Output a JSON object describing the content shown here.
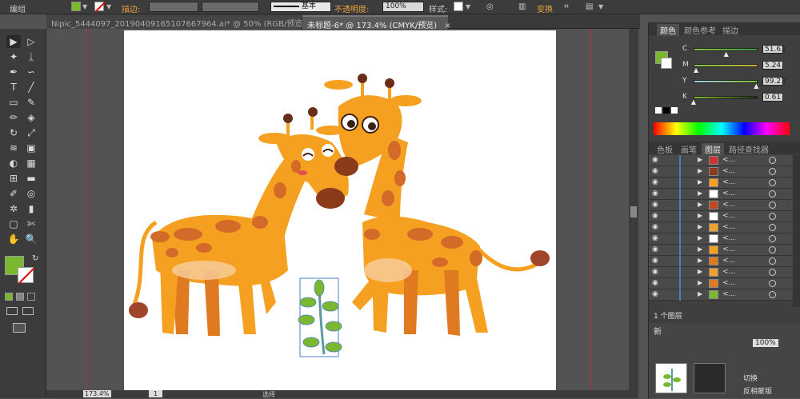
{
  "control_bar": {
    "group_label": "编组",
    "stroke_label": "描边:",
    "stroke_profile": "基本",
    "opacity_label": "不透明度:",
    "opacity_value": "100%",
    "style_label": "样式:",
    "transform_label": "变换",
    "fill_color": "#7ab830"
  },
  "doc_tabs": [
    {
      "title": "Nipic_5444097_20190409165107667964.ai* @ 50% (RGB/预览)",
      "close": "×"
    },
    {
      "title": "未标题-6* @ 173.4% (CMYK/预览)",
      "close": "×"
    }
  ],
  "tools": [
    "selection",
    "direct-selection",
    "magic-wand",
    "lasso",
    "pen",
    "curvature",
    "type",
    "line",
    "rectangle",
    "paintbrush",
    "pencil",
    "eraser",
    "rotate",
    "scale",
    "width",
    "free-transform",
    "shape-builder",
    "perspective",
    "mesh",
    "gradient",
    "eyedropper",
    "blend",
    "symbol-sprayer",
    "graph",
    "artboard",
    "slice",
    "hand",
    "zoom"
  ],
  "color_panel": {
    "tabs": [
      "颜色",
      "颜色参考",
      "描边"
    ],
    "channels": [
      {
        "name": "C",
        "value": "51.63",
        "pos": 0.52,
        "gradient": "linear-gradient(to right,#8cbf3e,#3a9a48)"
      },
      {
        "name": "M",
        "value": "5.24",
        "pos": 0.05,
        "gradient": "linear-gradient(to right,#78c850,#d0b040)"
      },
      {
        "name": "Y",
        "value": "99.23",
        "pos": 0.99,
        "gradient": "linear-gradient(to right,#a0d0e8,#80c030)"
      },
      {
        "name": "K",
        "value": "0.61",
        "pos": 0.01,
        "gradient": "linear-gradient(to right,#80c030,#203010)"
      }
    ]
  },
  "layers_panel": {
    "tabs": [
      "色板",
      "画笔",
      "图层",
      "路径查找器"
    ],
    "rows": [
      {
        "name": "<...",
        "thumb": "#c33"
      },
      {
        "name": "<...",
        "thumb": "#8b3a1a"
      },
      {
        "name": "<...",
        "thumb": "#f5a020"
      },
      {
        "name": "<...",
        "thumb": "#ffffff"
      },
      {
        "name": "<...",
        "thumb": "#c04a20"
      },
      {
        "name": "<...",
        "thumb": "#fff"
      },
      {
        "name": "<...",
        "thumb": "#f0a030"
      },
      {
        "name": "<...",
        "thumb": "#fff"
      },
      {
        "name": "<...",
        "thumb": "#f5a020"
      },
      {
        "name": "<...",
        "thumb": "#e07a20"
      },
      {
        "name": "<...",
        "thumb": "#f0a030"
      },
      {
        "name": "<...",
        "thumb": "#e07a20"
      },
      {
        "name": "<...",
        "thumb": "#7ab830"
      }
    ],
    "footer": "1 个图层"
  },
  "lower_panel": {
    "value": "100%",
    "buttons": [
      "切换",
      "反相蒙版"
    ],
    "tab": "新"
  },
  "status": {
    "zoom": "173.4%",
    "page": "1",
    "mode": "选择"
  }
}
